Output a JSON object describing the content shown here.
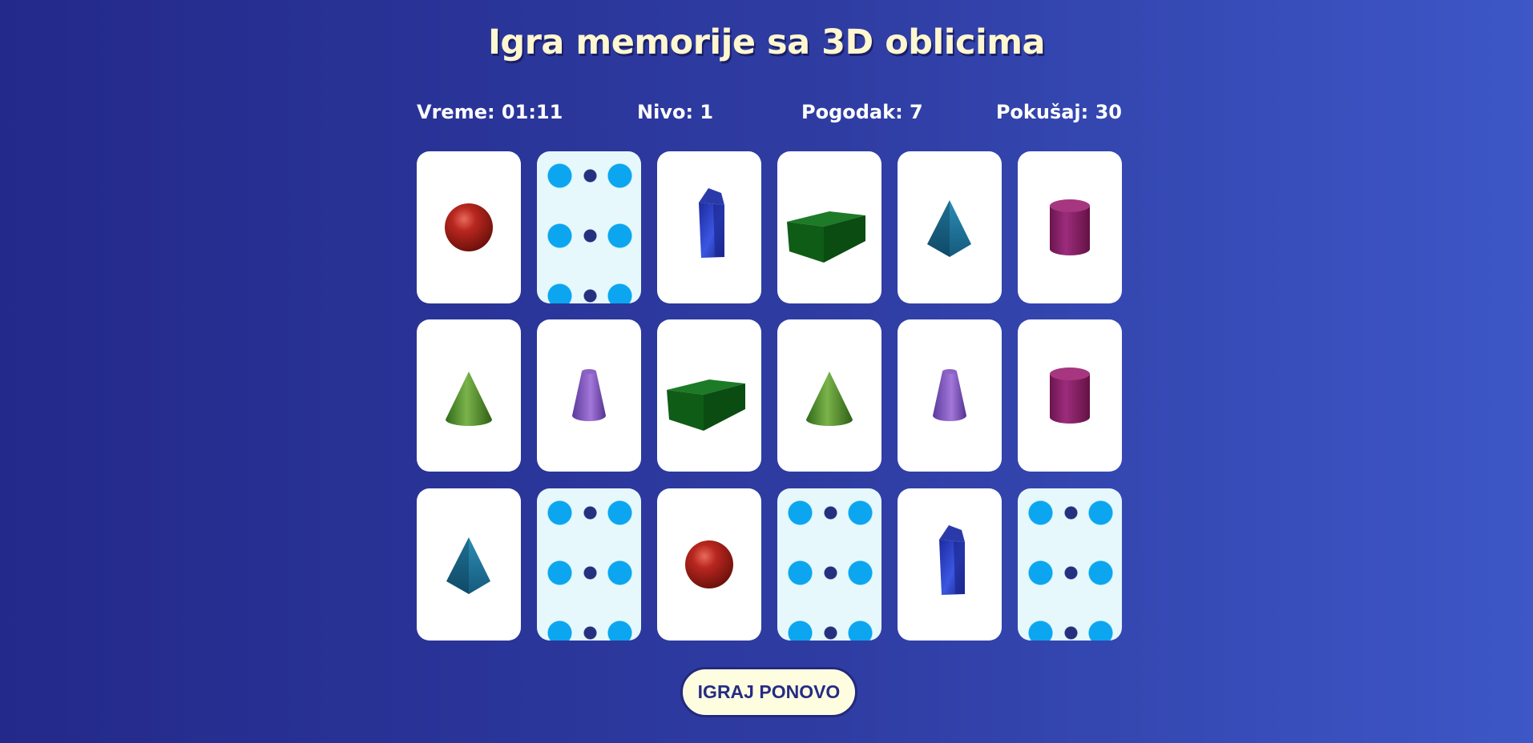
{
  "title": "Igra memorije sa 3D oblicima",
  "stats": {
    "time": "Vreme: 01:11",
    "level": "Nivo: 1",
    "hits": "Pogodak: 7",
    "tries": "Pokušaj: 30"
  },
  "board": {
    "rows": 3,
    "columns": 6,
    "cards": [
      {
        "state": "face-up",
        "shape": "sphere-icon"
      },
      {
        "state": "face-down"
      },
      {
        "state": "face-up",
        "shape": "prism-icon"
      },
      {
        "state": "face-up",
        "shape": "cuboid-icon"
      },
      {
        "state": "face-up",
        "shape": "pyramid-icon"
      },
      {
        "state": "face-up",
        "shape": "cylinder-icon"
      },
      {
        "state": "face-up",
        "shape": "cone-icon"
      },
      {
        "state": "face-up",
        "shape": "frustum-icon"
      },
      {
        "state": "face-up",
        "shape": "cuboid-icon"
      },
      {
        "state": "face-up",
        "shape": "cone-icon"
      },
      {
        "state": "face-up",
        "shape": "frustum-icon"
      },
      {
        "state": "face-up",
        "shape": "cylinder-icon"
      },
      {
        "state": "face-up",
        "shape": "pyramid-icon"
      },
      {
        "state": "face-down"
      },
      {
        "state": "face-up",
        "shape": "sphere-icon"
      },
      {
        "state": "face-down"
      },
      {
        "state": "face-up",
        "shape": "prism-icon"
      },
      {
        "state": "face-down"
      }
    ]
  },
  "replay_button": "IGRAJ PONOVO",
  "colors": {
    "title": "#fff7cf",
    "card_face": "#ffffff",
    "card_back_dots_large": "#0ba6ef",
    "card_back_dots_small": "#25307f",
    "card_back_base": "#e6f8fc",
    "button_bg": "#fffde0",
    "button_text": "#252c83"
  }
}
